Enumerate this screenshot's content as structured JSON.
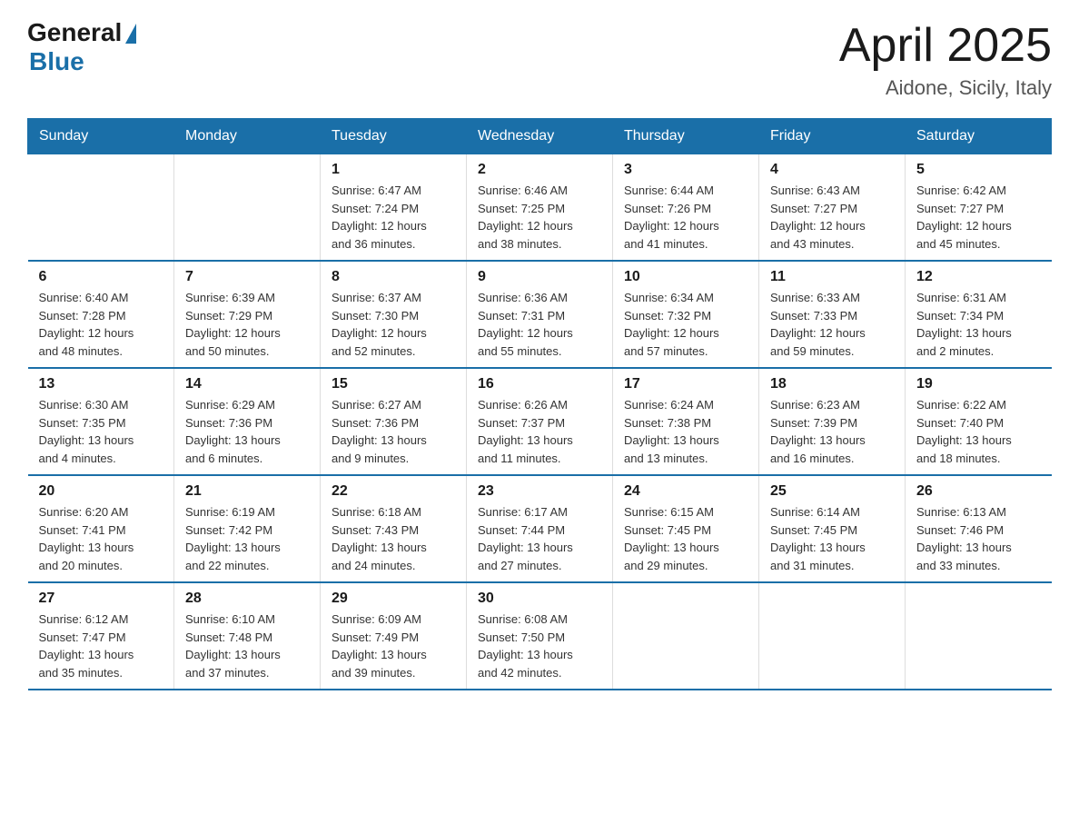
{
  "header": {
    "logo_general": "General",
    "logo_blue": "Blue",
    "title": "April 2025",
    "subtitle": "Aidone, Sicily, Italy"
  },
  "weekdays": [
    "Sunday",
    "Monday",
    "Tuesday",
    "Wednesday",
    "Thursday",
    "Friday",
    "Saturday"
  ],
  "weeks": [
    [
      {
        "day": "",
        "info": ""
      },
      {
        "day": "",
        "info": ""
      },
      {
        "day": "1",
        "info": "Sunrise: 6:47 AM\nSunset: 7:24 PM\nDaylight: 12 hours\nand 36 minutes."
      },
      {
        "day": "2",
        "info": "Sunrise: 6:46 AM\nSunset: 7:25 PM\nDaylight: 12 hours\nand 38 minutes."
      },
      {
        "day": "3",
        "info": "Sunrise: 6:44 AM\nSunset: 7:26 PM\nDaylight: 12 hours\nand 41 minutes."
      },
      {
        "day": "4",
        "info": "Sunrise: 6:43 AM\nSunset: 7:27 PM\nDaylight: 12 hours\nand 43 minutes."
      },
      {
        "day": "5",
        "info": "Sunrise: 6:42 AM\nSunset: 7:27 PM\nDaylight: 12 hours\nand 45 minutes."
      }
    ],
    [
      {
        "day": "6",
        "info": "Sunrise: 6:40 AM\nSunset: 7:28 PM\nDaylight: 12 hours\nand 48 minutes."
      },
      {
        "day": "7",
        "info": "Sunrise: 6:39 AM\nSunset: 7:29 PM\nDaylight: 12 hours\nand 50 minutes."
      },
      {
        "day": "8",
        "info": "Sunrise: 6:37 AM\nSunset: 7:30 PM\nDaylight: 12 hours\nand 52 minutes."
      },
      {
        "day": "9",
        "info": "Sunrise: 6:36 AM\nSunset: 7:31 PM\nDaylight: 12 hours\nand 55 minutes."
      },
      {
        "day": "10",
        "info": "Sunrise: 6:34 AM\nSunset: 7:32 PM\nDaylight: 12 hours\nand 57 minutes."
      },
      {
        "day": "11",
        "info": "Sunrise: 6:33 AM\nSunset: 7:33 PM\nDaylight: 12 hours\nand 59 minutes."
      },
      {
        "day": "12",
        "info": "Sunrise: 6:31 AM\nSunset: 7:34 PM\nDaylight: 13 hours\nand 2 minutes."
      }
    ],
    [
      {
        "day": "13",
        "info": "Sunrise: 6:30 AM\nSunset: 7:35 PM\nDaylight: 13 hours\nand 4 minutes."
      },
      {
        "day": "14",
        "info": "Sunrise: 6:29 AM\nSunset: 7:36 PM\nDaylight: 13 hours\nand 6 minutes."
      },
      {
        "day": "15",
        "info": "Sunrise: 6:27 AM\nSunset: 7:36 PM\nDaylight: 13 hours\nand 9 minutes."
      },
      {
        "day": "16",
        "info": "Sunrise: 6:26 AM\nSunset: 7:37 PM\nDaylight: 13 hours\nand 11 minutes."
      },
      {
        "day": "17",
        "info": "Sunrise: 6:24 AM\nSunset: 7:38 PM\nDaylight: 13 hours\nand 13 minutes."
      },
      {
        "day": "18",
        "info": "Sunrise: 6:23 AM\nSunset: 7:39 PM\nDaylight: 13 hours\nand 16 minutes."
      },
      {
        "day": "19",
        "info": "Sunrise: 6:22 AM\nSunset: 7:40 PM\nDaylight: 13 hours\nand 18 minutes."
      }
    ],
    [
      {
        "day": "20",
        "info": "Sunrise: 6:20 AM\nSunset: 7:41 PM\nDaylight: 13 hours\nand 20 minutes."
      },
      {
        "day": "21",
        "info": "Sunrise: 6:19 AM\nSunset: 7:42 PM\nDaylight: 13 hours\nand 22 minutes."
      },
      {
        "day": "22",
        "info": "Sunrise: 6:18 AM\nSunset: 7:43 PM\nDaylight: 13 hours\nand 24 minutes."
      },
      {
        "day": "23",
        "info": "Sunrise: 6:17 AM\nSunset: 7:44 PM\nDaylight: 13 hours\nand 27 minutes."
      },
      {
        "day": "24",
        "info": "Sunrise: 6:15 AM\nSunset: 7:45 PM\nDaylight: 13 hours\nand 29 minutes."
      },
      {
        "day": "25",
        "info": "Sunrise: 6:14 AM\nSunset: 7:45 PM\nDaylight: 13 hours\nand 31 minutes."
      },
      {
        "day": "26",
        "info": "Sunrise: 6:13 AM\nSunset: 7:46 PM\nDaylight: 13 hours\nand 33 minutes."
      }
    ],
    [
      {
        "day": "27",
        "info": "Sunrise: 6:12 AM\nSunset: 7:47 PM\nDaylight: 13 hours\nand 35 minutes."
      },
      {
        "day": "28",
        "info": "Sunrise: 6:10 AM\nSunset: 7:48 PM\nDaylight: 13 hours\nand 37 minutes."
      },
      {
        "day": "29",
        "info": "Sunrise: 6:09 AM\nSunset: 7:49 PM\nDaylight: 13 hours\nand 39 minutes."
      },
      {
        "day": "30",
        "info": "Sunrise: 6:08 AM\nSunset: 7:50 PM\nDaylight: 13 hours\nand 42 minutes."
      },
      {
        "day": "",
        "info": ""
      },
      {
        "day": "",
        "info": ""
      },
      {
        "day": "",
        "info": ""
      }
    ]
  ]
}
